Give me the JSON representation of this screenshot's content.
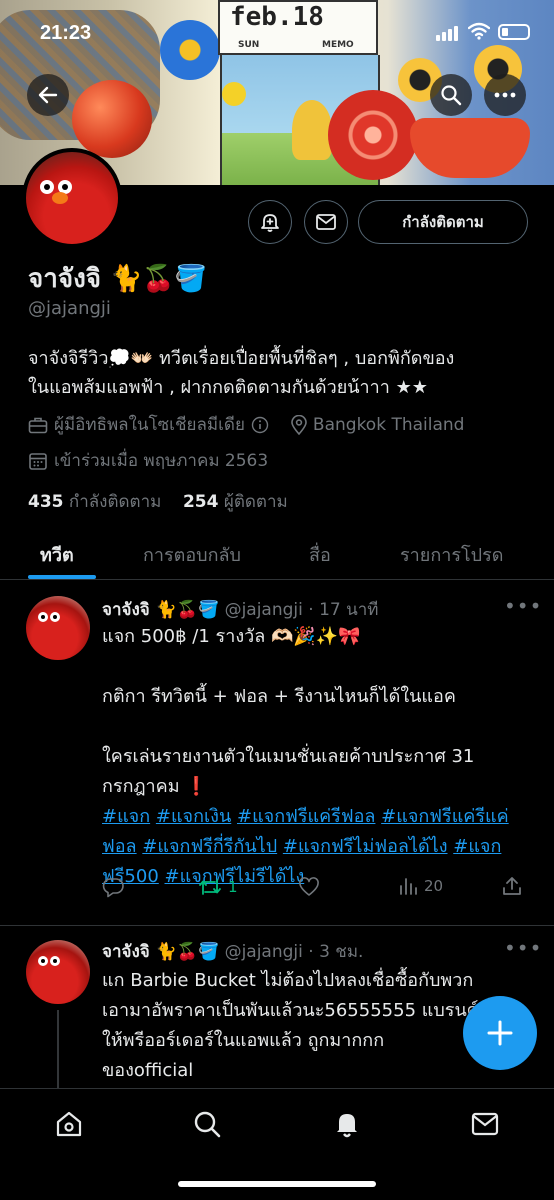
{
  "status_bar": {
    "time": "21:23"
  },
  "banner": {
    "calendar_date": "feb.18",
    "calendar_sun": "SUN",
    "calendar_memo": "MEMO"
  },
  "profile": {
    "name": "จาจังจิ 🐈🍒🪣",
    "handle": "@jajangji",
    "bio_line1": "จาจังจิรีวิว💭👐🏻 ทวีตเรื่อยเปื่อยพื้นที่ชิลๆ , บอกพิกัดของ",
    "bio_line2": "ในแอพส้มแอพฟ้า , ฝากกดติดตามกันด้วยน้าาา ★★",
    "category": "ผู้มีอิทธิพลในโซเชียลมีเดีย",
    "location": "Bangkok Thailand",
    "joined": "เข้าร่วมเมื่อ พฤษภาคม 2563",
    "following_count": "435",
    "following_label": "กำลังติดตาม",
    "followers_count": "254",
    "followers_label": "ผู้ติดตาม",
    "follow_button": "กำลังติดตาม"
  },
  "tabs": [
    "ทวีต",
    "การตอบกลับ",
    "สื่อ",
    "รายการโปรด"
  ],
  "tweets": [
    {
      "name": "จาจังจิ 🐈🍒🪣",
      "handle": "@jajangji",
      "time": "· 17 นาที",
      "line1": "แจก  500฿ /1 รางวัล 🫶🏻🎉✨🎀",
      "line2": "กติกา รีทวิตนี้ + ฟอล + รีงานไหนก็ได้ในแอค",
      "line3": "ใครเล่นรายงานตัวในเมนชั่นเลยค้าบประกาศ 31",
      "line4": "กรกฎาคม ❗️",
      "hashtags": [
        "#แจก",
        "#แจกเงิน",
        "#แจกฟรีแค่รีฟอล",
        "#แจกฟรีแค่รีแค่ฟอล",
        "#แจกฟรีกี่รีกันไป",
        "#แจกฟรีไม่ฟอลได้ไง",
        "#แจกฟรี500",
        "#แจกฟรีไม่รีได้ไง"
      ],
      "retweets": "1",
      "views": "20"
    },
    {
      "name": "จาจังจิ 🐈🍒🪣",
      "handle": "@jajangji",
      "time": "· 3 ชม.",
      "line1": "แก Barbie Bucket ไม่ต้องไปหลงเชื่อซื้อกับพวก",
      "line2": "เอามาอัพราคาเป็นพันแล้วนะ56555555 แบรนด์",
      "line3": "ให้พรีออร์เดอร์ในแอพแล้ว ถูกมากกก",
      "line4": "ของofficial"
    }
  ],
  "icons": {
    "back": "arrow-left-icon",
    "search": "search-icon",
    "more": "more-icon",
    "notify": "bell-plus-icon",
    "message": "mail-icon",
    "category": "briefcase-icon",
    "info": "info-icon",
    "location": "location-pin-icon",
    "calendar": "calendar-icon"
  },
  "colors": {
    "accent": "#1d9bf0",
    "retweet_active": "#00ba7c",
    "muted": "#71767b",
    "background": "#000000"
  }
}
